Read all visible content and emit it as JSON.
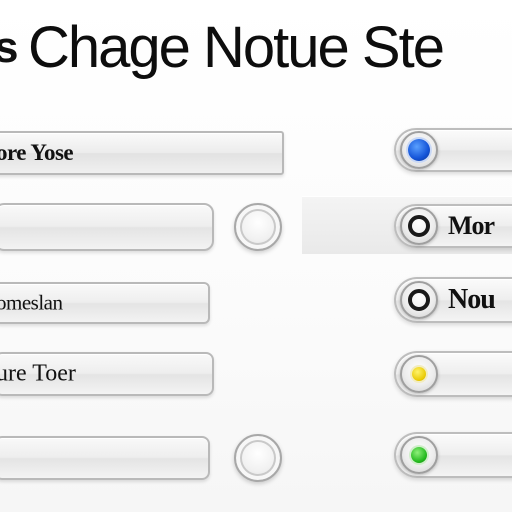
{
  "title": {
    "prefix": "s",
    "text": "Chage Notue Ste"
  },
  "fields": [
    {
      "label": "ore Yose"
    },
    {
      "label": ""
    },
    {
      "label": "omeslan"
    },
    {
      "label": "ure Toer"
    },
    {
      "label": ""
    }
  ],
  "round_buttons": [
    {
      "icon": "round-button-icon"
    },
    {
      "icon": "round-button-icon"
    }
  ],
  "pills": [
    {
      "label": "",
      "indicator": "blue-dot-icon",
      "indicator_color": "#1454d8"
    },
    {
      "label": "Mor",
      "indicator": "ring-icon",
      "indicator_color": "#1a1a1a"
    },
    {
      "label": "Nou",
      "indicator": "ring-icon",
      "indicator_color": "#1a1a1a"
    },
    {
      "label": "",
      "indicator": "yellow-dot-icon",
      "indicator_color": "#e8c800"
    },
    {
      "label": "",
      "indicator": "green-dot-icon",
      "indicator_color": "#22b81c"
    }
  ]
}
